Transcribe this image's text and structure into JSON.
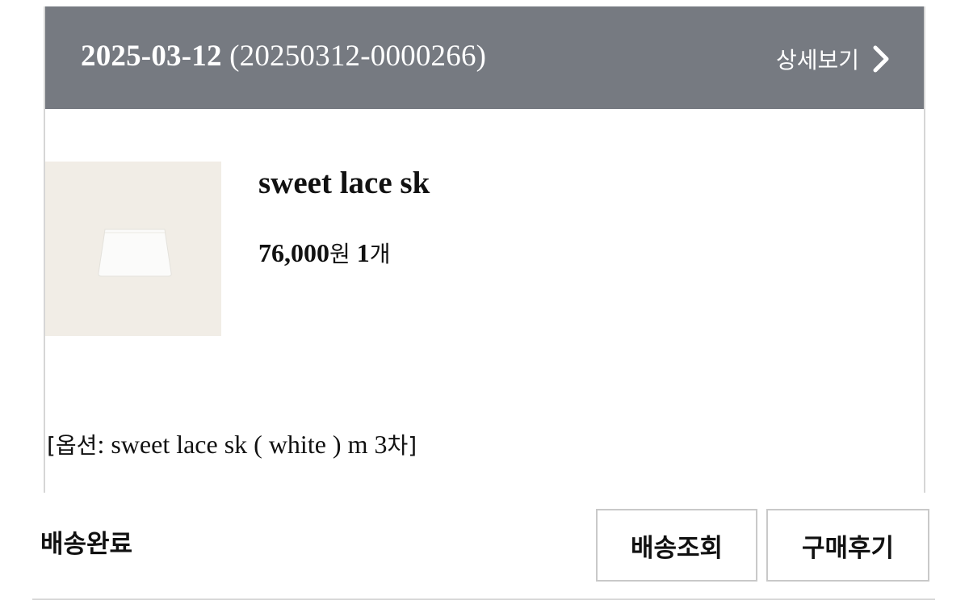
{
  "order": {
    "date": "2025-03-12",
    "number_text": "(20250312-0000266)",
    "detail_label": "상세보기",
    "detail_icon": "chevron-right-icon",
    "header_bg": "#767a81"
  },
  "product": {
    "name": "sweet lace sk",
    "price": "76,000",
    "currency": "원",
    "quantity": "1",
    "quantity_unit": "개",
    "thumbnail_icon": "skirt-image"
  },
  "option": {
    "prefix": "[옵션",
    "text": ": sweet lace sk ( white ) m 3",
    "suffix": "차]"
  },
  "status": {
    "label": "배송완료"
  },
  "actions": {
    "track_label": "배송조회",
    "review_label": "구매후기"
  }
}
